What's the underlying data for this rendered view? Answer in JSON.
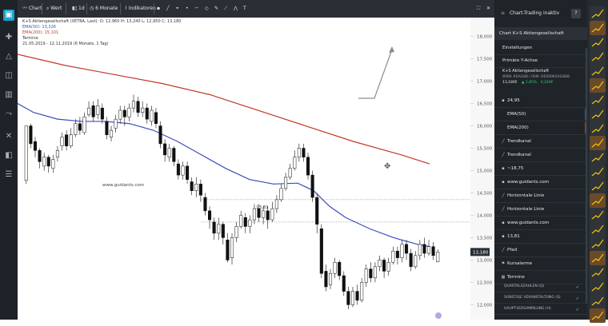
{
  "toolbar": {
    "chart_label": "Chart",
    "wert_label": "Wert",
    "interval_label": "1d",
    "range_label": "6 Monate",
    "indicators_label": "Indikatoren"
  },
  "legend": {
    "instrument": "K+S Aktiengesellschaft (XETRA, Last): O: 12,960  H: 13,240  L: 12,950  C: 13,180",
    "ema50": "EMA(50): 13,326",
    "ema200": "EMA(200): 15,101",
    "termine": "Termine",
    "date_range": "21.05.2019 - 12.11.2019  (6 Monate, 1 Tag)"
  },
  "chart_data": {
    "type": "candlestick",
    "y_ticks": [
      "18,000",
      "17,500",
      "17,000",
      "16,500",
      "16,000",
      "15,500",
      "15,000",
      "14,500",
      "14,000",
      "13,500",
      "13,000",
      "12,500",
      "12,000"
    ],
    "ylim": [
      11.9,
      18.1
    ],
    "current_price": "13,180",
    "support_label": "13,81",
    "watermark": "www.guidants.com",
    "ema50_color": "#3a4cc0",
    "ema200_color": "#c0392b",
    "ema200": [
      [
        0,
        17.6
      ],
      [
        60,
        17.35
      ],
      [
        120,
        17.15
      ],
      [
        180,
        16.95
      ],
      [
        240,
        16.7
      ],
      [
        300,
        16.35
      ],
      [
        360,
        16.0
      ],
      [
        420,
        15.65
      ],
      [
        480,
        15.35
      ],
      [
        515,
        15.15
      ]
    ],
    "ema50": [
      [
        0,
        16.5
      ],
      [
        20,
        16.3
      ],
      [
        50,
        16.15
      ],
      [
        80,
        16.1
      ],
      [
        110,
        16.1
      ],
      [
        140,
        16.05
      ],
      [
        170,
        15.9
      ],
      [
        200,
        15.65
      ],
      [
        230,
        15.35
      ],
      [
        260,
        15.05
      ],
      [
        290,
        14.8
      ],
      [
        320,
        14.7
      ],
      [
        350,
        14.72
      ],
      [
        370,
        14.55
      ],
      [
        390,
        14.2
      ],
      [
        410,
        13.95
      ],
      [
        440,
        13.7
      ],
      [
        470,
        13.5
      ],
      [
        500,
        13.35
      ],
      [
        515,
        13.3
      ]
    ],
    "candles": [
      [
        14.78,
        16.0,
        15.85,
        14.7
      ],
      [
        16.0,
        15.6,
        16.05,
        15.5
      ],
      [
        15.65,
        15.45,
        15.75,
        15.3
      ],
      [
        15.45,
        15.2,
        15.5,
        15.05
      ],
      [
        15.1,
        15.3,
        15.4,
        15.0
      ],
      [
        15.3,
        15.1,
        15.35,
        14.95
      ],
      [
        15.05,
        15.25,
        15.35,
        14.95
      ],
      [
        15.3,
        15.45,
        15.55,
        15.2
      ],
      [
        15.55,
        15.75,
        15.85,
        15.45
      ],
      [
        15.8,
        15.55,
        15.9,
        15.45
      ],
      [
        15.55,
        15.8,
        15.95,
        15.5
      ],
      [
        15.8,
        16.05,
        16.15,
        15.75
      ],
      [
        16.05,
        15.9,
        16.2,
        15.8
      ],
      [
        15.85,
        16.2,
        16.3,
        15.8
      ],
      [
        16.25,
        16.4,
        16.55,
        16.2
      ],
      [
        16.45,
        16.2,
        16.55,
        16.1
      ],
      [
        16.25,
        16.45,
        16.6,
        16.15
      ],
      [
        16.4,
        16.15,
        16.5,
        16.05
      ],
      [
        16.1,
        15.8,
        16.2,
        15.7
      ],
      [
        15.75,
        15.9,
        16.0,
        15.65
      ],
      [
        15.95,
        16.15,
        16.25,
        15.85
      ],
      [
        16.15,
        16.35,
        16.45,
        16.05
      ],
      [
        16.35,
        16.2,
        16.45,
        16.0
      ],
      [
        16.2,
        16.4,
        16.5,
        16.1
      ],
      [
        16.4,
        16.55,
        16.7,
        16.3
      ],
      [
        16.55,
        16.3,
        16.65,
        16.2
      ],
      [
        16.3,
        16.4,
        16.55,
        16.2
      ],
      [
        16.4,
        16.15,
        16.5,
        16.05
      ],
      [
        16.1,
        16.35,
        16.45,
        16.0
      ],
      [
        16.3,
        16.05,
        16.4,
        15.95
      ],
      [
        16.0,
        15.6,
        16.1,
        15.5
      ],
      [
        15.6,
        15.35,
        15.7,
        15.2
      ],
      [
        15.3,
        15.5,
        15.6,
        15.2
      ],
      [
        15.5,
        15.2,
        15.55,
        15.1
      ],
      [
        15.15,
        14.9,
        15.25,
        14.8
      ],
      [
        14.9,
        15.1,
        15.2,
        14.8
      ],
      [
        15.1,
        14.8,
        15.2,
        14.7
      ],
      [
        14.75,
        14.55,
        14.85,
        14.45
      ],
      [
        14.55,
        14.7,
        14.85,
        14.4
      ],
      [
        14.7,
        14.45,
        14.8,
        14.3
      ],
      [
        14.4,
        14.1,
        14.5,
        14.0
      ],
      [
        14.1,
        13.9,
        14.2,
        13.7
      ],
      [
        13.85,
        13.6,
        13.95,
        13.45
      ],
      [
        13.6,
        13.8,
        13.95,
        13.45
      ],
      [
        13.8,
        13.5,
        13.85,
        13.35
      ],
      [
        13.45,
        13.0,
        13.6,
        12.95
      ],
      [
        13.05,
        13.5,
        13.6,
        12.9
      ],
      [
        13.5,
        13.75,
        13.85,
        13.4
      ],
      [
        13.75,
        14.0,
        14.1,
        13.7
      ],
      [
        13.95,
        13.75,
        14.05,
        13.6
      ],
      [
        13.75,
        13.9,
        14.0,
        13.6
      ],
      [
        13.9,
        14.15,
        14.25,
        13.8
      ],
      [
        14.15,
        13.95,
        14.25,
        13.85
      ],
      [
        13.95,
        14.1,
        14.2,
        13.8
      ],
      [
        14.1,
        13.9,
        14.2,
        13.7
      ],
      [
        13.9,
        14.15,
        14.3,
        13.85
      ],
      [
        14.15,
        14.35,
        14.45,
        14.05
      ],
      [
        14.35,
        14.6,
        14.7,
        14.3
      ],
      [
        14.6,
        14.85,
        14.95,
        14.55
      ],
      [
        14.85,
        15.05,
        15.15,
        14.8
      ],
      [
        15.05,
        15.3,
        15.45,
        15.0
      ],
      [
        15.3,
        15.5,
        15.6,
        15.2
      ],
      [
        15.5,
        15.3,
        15.6,
        15.2
      ],
      [
        15.3,
        14.9,
        15.4,
        14.8
      ],
      [
        14.9,
        14.4,
        15.0,
        14.3
      ],
      [
        14.4,
        13.8,
        14.5,
        13.6
      ],
      [
        13.7,
        12.7,
        13.8,
        12.6
      ],
      [
        12.75,
        12.4,
        12.9,
        12.3
      ],
      [
        12.45,
        12.7,
        12.8,
        12.35
      ],
      [
        12.7,
        12.95,
        13.05,
        12.6
      ],
      [
        12.95,
        12.65,
        13.0,
        12.55
      ],
      [
        12.65,
        12.3,
        12.75,
        12.2
      ],
      [
        12.3,
        12.0,
        12.4,
        11.9
      ],
      [
        12.0,
        12.3,
        12.4,
        11.95
      ],
      [
        12.3,
        12.1,
        12.45,
        12.0
      ],
      [
        12.1,
        12.5,
        12.6,
        12.05
      ],
      [
        12.5,
        12.8,
        12.9,
        12.4
      ],
      [
        12.8,
        12.6,
        12.95,
        12.5
      ],
      [
        12.6,
        12.85,
        12.95,
        12.5
      ],
      [
        12.85,
        13.0,
        13.1,
        12.75
      ],
      [
        13.0,
        12.75,
        13.05,
        12.6
      ],
      [
        12.75,
        12.95,
        13.05,
        12.65
      ],
      [
        12.95,
        13.2,
        13.3,
        12.9
      ],
      [
        13.2,
        13.05,
        13.3,
        12.9
      ],
      [
        13.05,
        13.35,
        13.45,
        12.95
      ],
      [
        13.35,
        13.15,
        13.45,
        13.0
      ],
      [
        13.15,
        12.85,
        13.25,
        12.75
      ],
      [
        12.85,
        13.1,
        13.2,
        12.8
      ],
      [
        13.1,
        13.35,
        13.45,
        13.0
      ],
      [
        13.35,
        13.15,
        13.5,
        13.05
      ],
      [
        13.15,
        13.3,
        13.45,
        13.1
      ],
      [
        13.3,
        13.1,
        13.4,
        13.0
      ],
      [
        12.96,
        13.18,
        13.24,
        12.95
      ]
    ]
  },
  "overlay": {
    "zoom_icon": "crosshair-icon",
    "badge": "circle"
  },
  "rightpanel": {
    "title": "Chart-Trading inaktiv",
    "help": "?",
    "section": "Chart K+S Aktiengesellschaft",
    "items": [
      "Einstellungen",
      "Primäre Y-Achse"
    ],
    "quote_name": "K+S Aktiengesellschaft",
    "quote_ids": "WKN: KSAG88 / ISIN: DE000KSAG888",
    "quote_price": "13,180€",
    "quote_change": "1,85%",
    "quote_abs": "0,240€",
    "rows": [
      {
        "label": "24,95",
        "icon": "dot-icon"
      },
      {
        "label": "EMA(50)",
        "icon": ""
      },
      {
        "label": "EMA(200)",
        "icon": ""
      },
      {
        "label": "Trendkanal",
        "icon": "line-icon"
      },
      {
        "label": "Trendkanal",
        "icon": "line-icon"
      },
      {
        "label": "~18,75",
        "icon": "dot-icon"
      },
      {
        "label": "www.guidants.com",
        "icon": "dot-icon"
      },
      {
        "label": "Horizontale Linie",
        "icon": "line-icon"
      },
      {
        "label": "Horizontale Linie",
        "icon": "line-icon"
      },
      {
        "label": "www.guidants.com",
        "icon": "dot-icon"
      },
      {
        "label": "13,81",
        "icon": "dot-icon"
      },
      {
        "label": "Pfad",
        "icon": "line-icon"
      },
      {
        "label": "Kursalarme",
        "icon": "bell-icon"
      },
      {
        "label": "Termine",
        "icon": "calendar-icon"
      }
    ],
    "termine_items": [
      "QUARTALSZAHLEN (Q)",
      "SONSTIGE VERANSTALTUNG (S)",
      "HAUPTVERSAMMLUNG (H)"
    ],
    "accent": "#1da1c9",
    "positive_color": "#2ecc71"
  }
}
